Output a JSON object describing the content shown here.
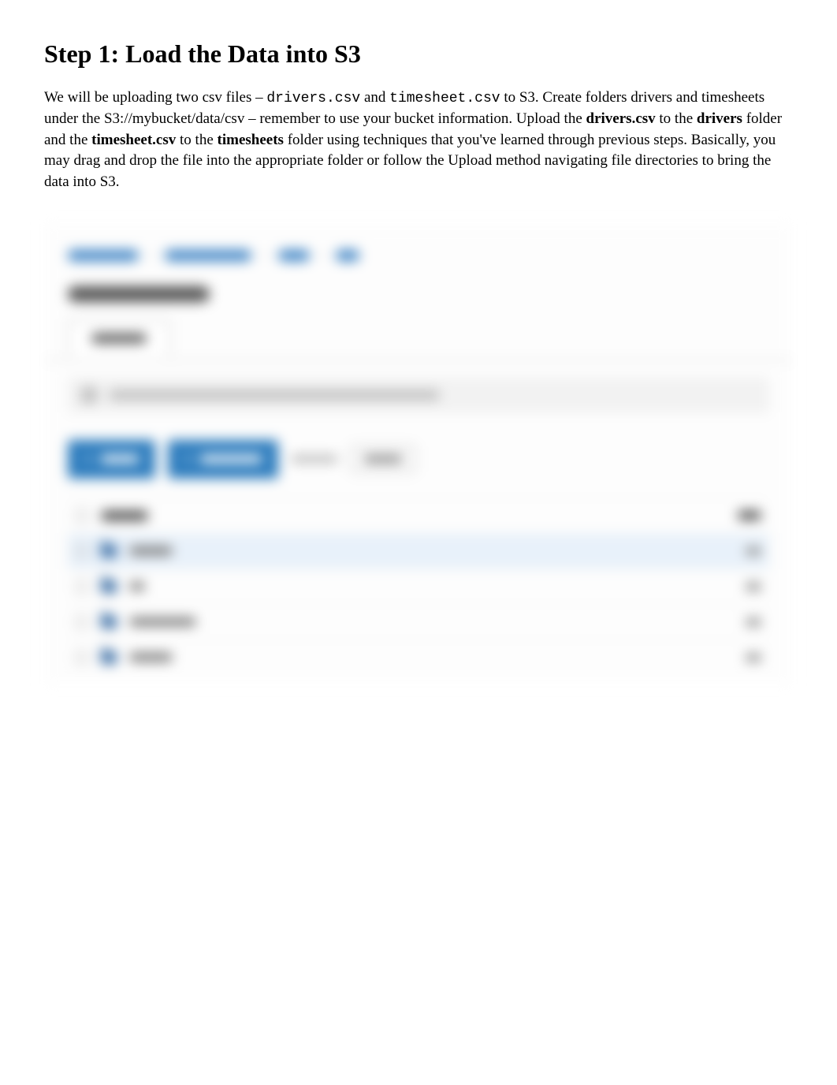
{
  "heading": "Step 1: Load the Data into S3",
  "paragraph": {
    "p1": "We will be uploading two csv files – ",
    "code1": "drivers.csv",
    "p2": " and ",
    "code2": "timesheet.csv",
    "p3": " to S3.  Create folders drivers and timesheets under the S3://mybucket/data/csv – remember to use your bucket information.  Upload the ",
    "b1": "drivers.csv",
    "p4": " to the ",
    "b2": "drivers",
    "p5": " folder and the ",
    "b3": "timesheet.csv",
    "p6": " to the ",
    "b4": "timesheets",
    "p7": " folder using techniques that you've learned through previous steps. Basically, you may drag and drop the file into the appropriate folder or follow the Upload method navigating file directories to bring the data into S3."
  },
  "screenshot_note": "Embedded S3 console screenshot is heavily blurred; text content is not legible."
}
